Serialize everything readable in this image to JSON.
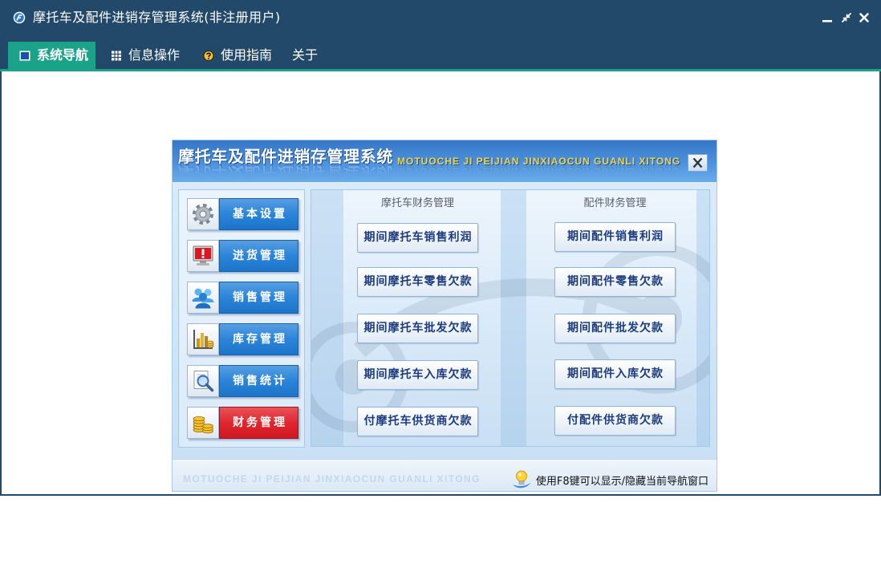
{
  "window": {
    "title": "摩托车及配件进销存管理系统(非注册用户)",
    "logo_icon": "app-logo-icon",
    "controls": [
      "minimize-icon",
      "restore-icon",
      "close-icon"
    ]
  },
  "menu": [
    {
      "label": "系统导航",
      "icon": "navigation-icon",
      "active": true
    },
    {
      "label": "信息操作",
      "icon": "grid-icon",
      "active": false
    },
    {
      "label": "使用指南",
      "icon": "help-icon",
      "active": false
    },
    {
      "label": "关于",
      "active": false
    }
  ],
  "dialog": {
    "title": "摩托车及配件进销存管理系统",
    "subtitle": "MOTUOCHE JI PEIJIAN JINXIAOCUN GUANLI XITONG",
    "close_icon": "close-icon",
    "nav": [
      {
        "label": "基本设置",
        "icon": "gear-icon",
        "active": false
      },
      {
        "label": "进货管理",
        "icon": "alert-monitor-icon",
        "active": false
      },
      {
        "label": "销售管理",
        "icon": "users-icon",
        "active": false
      },
      {
        "label": "库存管理",
        "icon": "inventory-chart-icon",
        "active": false
      },
      {
        "label": "销售统计",
        "icon": "search-report-icon",
        "active": false
      },
      {
        "label": "财务管理",
        "icon": "coins-icon",
        "active": true
      }
    ],
    "columns": [
      {
        "heading": "摩托车财务管理",
        "buttons": [
          "期间摩托车销售利润",
          "期间摩托车零售欠款",
          "期间摩托车批发欠款",
          "期间摩托车入库欠款",
          "付摩托车供货商欠款"
        ]
      },
      {
        "heading": "配件财务管理",
        "buttons": [
          "期间配件销售利润",
          "期间配件零售欠款",
          "期间配件批发欠款",
          "期间配件入库欠款",
          "付配件供货商欠款"
        ]
      }
    ],
    "footer": {
      "watermark": "MOTUOCHE JI PEIJIAN JINXIAOCUN GUANLI XITONG",
      "hint": "使用F8键可以显示/隐藏当前导航窗口",
      "hint_icon": "lightbulb-icon"
    }
  },
  "colors": {
    "titlebar": "#22496a",
    "accent": "#1ba38a",
    "nav_button": "#1f7ed8",
    "nav_button_active": "#e01a23",
    "finance_button_text": "#1c3b7e",
    "subtitle": "#f6d43c"
  }
}
